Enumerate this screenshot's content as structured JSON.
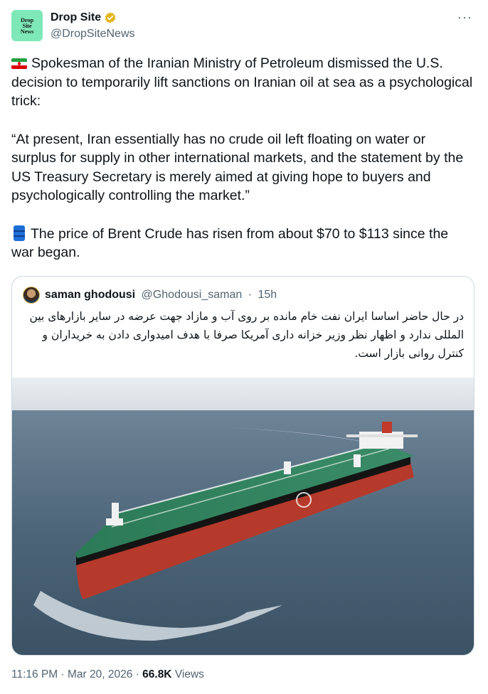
{
  "author": {
    "name": "Drop Site",
    "handle": "@DropSiteNews",
    "avatar_lines": [
      "Drop",
      "Site",
      "News"
    ]
  },
  "more_label": "···",
  "tweet": {
    "paragraph1": "Spokesman of the Iranian Ministry of Petroleum dismissed the U.S. decision to temporarily lift sanctions on Iranian oil at sea as a psychological trick:",
    "paragraph2": "“At present, Iran essentially has no crude oil left floating on water or surplus for supply in other international markets, and the statement by the US Treasury Secretary is merely aimed at giving hope to buyers and psychologically controlling the market.”",
    "paragraph3": "The price of Brent Crude has risen from about $70 to $113 since the war began."
  },
  "quote": {
    "name": "saman ghodousi",
    "handle": "@Ghodousi_saman",
    "separator": "·",
    "time": "15h",
    "text": "در حال حاضر اساسا ایران نفت خام مانده بر روی آب و مازاد جهت عرضه در سایر بازارهای بین المللی ندارد و اظهار نظر وزیر خزانه داری آمریکا صرفا با هدف امیدواری دادن به خریداران و کنترل روانی بازار است."
  },
  "meta": {
    "time": "11:16 PM",
    "sep1": "·",
    "date": "Mar 20, 2026",
    "sep2": "·",
    "views_count": "66.8K",
    "views_label": "Views"
  },
  "colors": {
    "text": "#0f1419",
    "secondary": "#536471",
    "border": "#cfd9de",
    "verified_gold": "#e2b719",
    "avatar_bg": "#7ee8b8",
    "ship_deck": "#2e7d5b",
    "ship_hull": "#c0392b",
    "sea": "#4a6578"
  },
  "icons": [
    "verified-badge-icon",
    "iran-flag-icon",
    "oil-barrel-icon",
    "more-icon"
  ]
}
